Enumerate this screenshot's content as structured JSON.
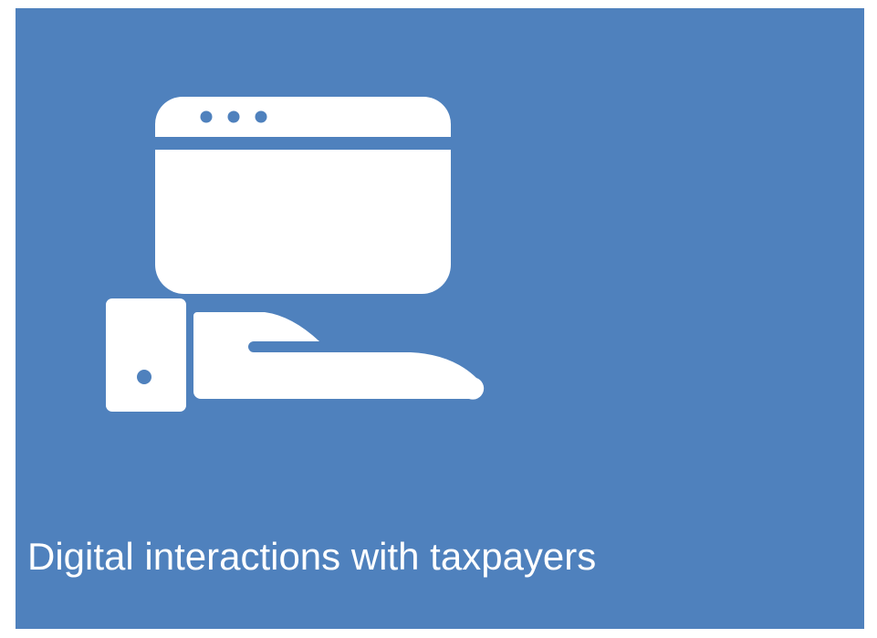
{
  "tile": {
    "caption": "Digital interactions with taxpayers",
    "background_color": "#4f81bd",
    "foreground_color": "#ffffff"
  },
  "icons": {
    "main_icon": "browser-window-device-hand-icon",
    "browser": "browser-window-icon",
    "phone": "mobile-phone-icon",
    "hand": "hand-icon"
  }
}
